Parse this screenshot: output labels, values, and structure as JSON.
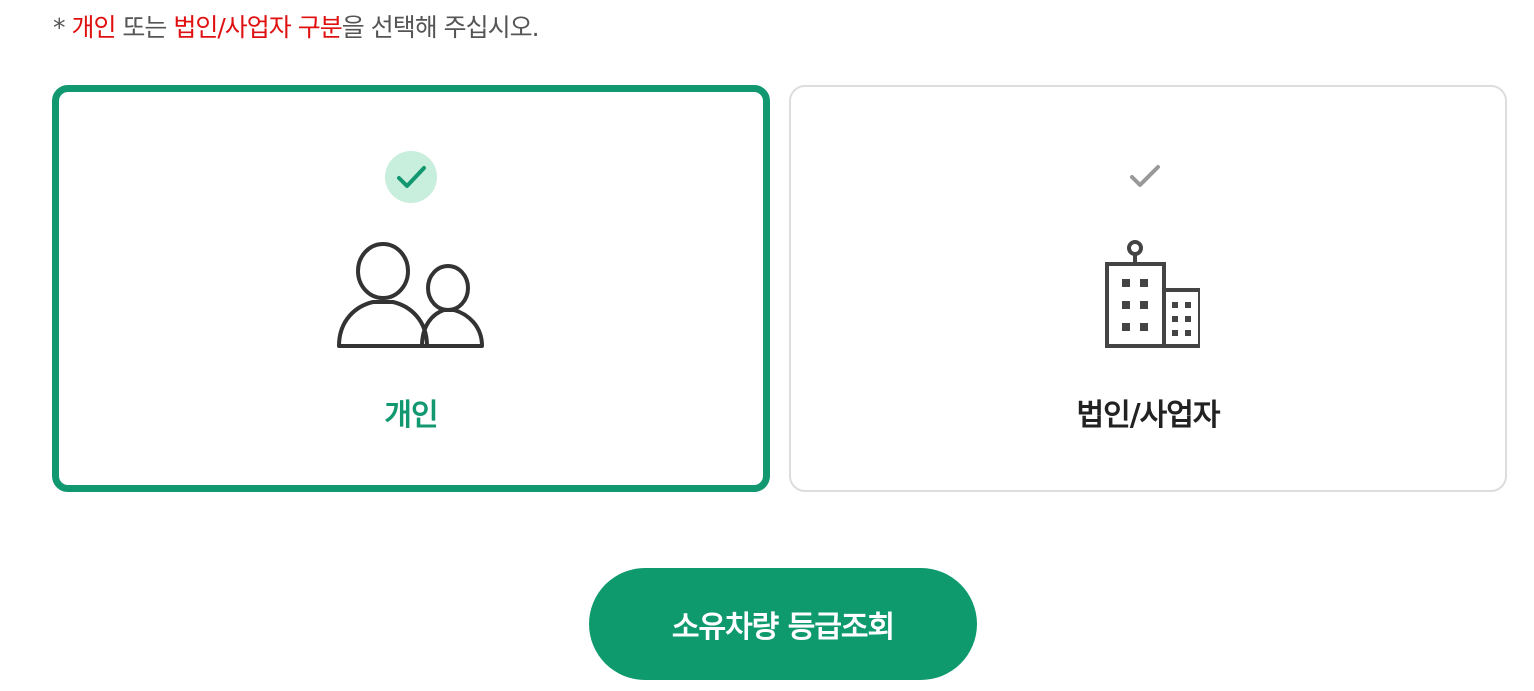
{
  "instruction": {
    "prefix": "* ",
    "highlight_1": "개인",
    "mid": " 또는 ",
    "highlight_2": "법인/사업자 구분",
    "suffix": "을 선택해 주십시오."
  },
  "options": [
    {
      "label": "개인",
      "selected": true,
      "icon": "people-icon"
    },
    {
      "label": "법인/사업자",
      "selected": false,
      "icon": "building-icon"
    }
  ],
  "submit": {
    "label": "소유차량 등급조회"
  },
  "colors": {
    "accent": "#119870",
    "highlight": "#e01010",
    "check_bg_selected": "#c8eedd",
    "check_unselected": "#999999",
    "text_dark": "#222222"
  }
}
